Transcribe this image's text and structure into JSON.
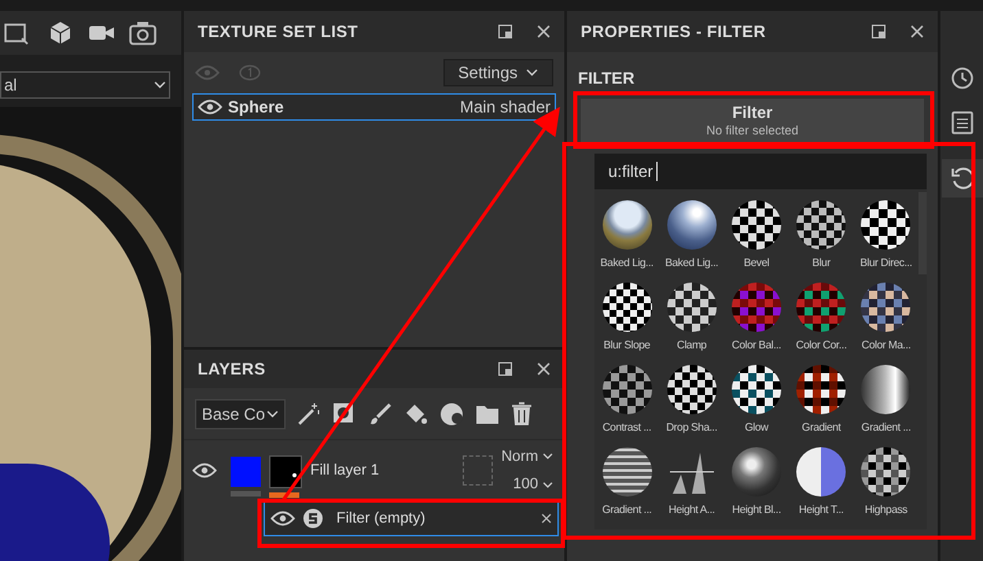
{
  "viewport": {
    "shading_dropdown": "al"
  },
  "texture_set_list": {
    "title": "TEXTURE SET LIST",
    "settings": "Settings",
    "items": [
      {
        "name": "Sphere",
        "shader": "Main shader",
        "selected": true,
        "visible": true
      }
    ]
  },
  "layers": {
    "title": "LAYERS",
    "channel_dropdown": "Base Co",
    "items": [
      {
        "name": "Fill layer 1",
        "blend": "Norm",
        "opacity": "100",
        "visible": true,
        "effects": [
          {
            "name": "Filter (empty)",
            "selected": true,
            "visible": true
          }
        ]
      }
    ]
  },
  "properties": {
    "title": "PROPERTIES - FILTER",
    "section": "FILTER",
    "filter_button": "Filter",
    "filter_status": "No filter selected",
    "search": "u:filter",
    "resources": [
      "Baked Lig...",
      "Baked Lig...",
      "Bevel",
      "Blur",
      "Blur Direc...",
      "Blur Slope",
      "Clamp",
      "Color Bal...",
      "Color Cor...",
      "Color Ma...",
      "Contrast ...",
      "Drop Sha...",
      "Glow",
      "Gradient",
      "Gradient ...",
      "Gradient ...",
      "Height A...",
      "Height Bl...",
      "Height T...",
      "Highpass"
    ]
  }
}
